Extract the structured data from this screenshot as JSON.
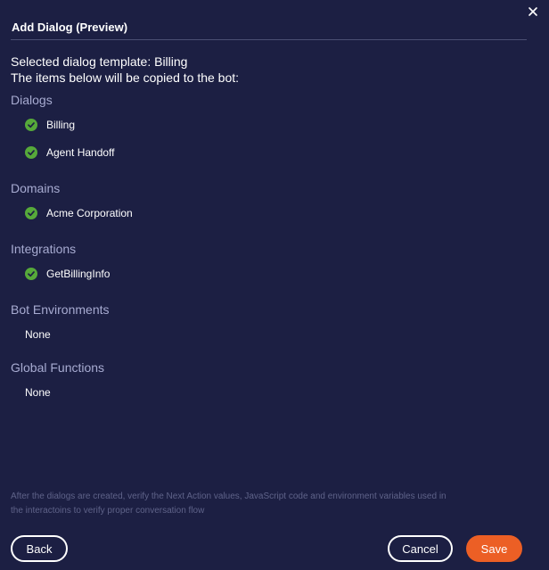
{
  "dialog": {
    "title": "Add Dialog (Preview)",
    "close_icon": "close-icon",
    "intro_line1": "Selected dialog template: Billing",
    "intro_line2": "The items below will be copied to the bot:"
  },
  "sections": {
    "dialogs": {
      "title": "Dialogs",
      "items": [
        "Billing",
        "Agent Handoff"
      ]
    },
    "domains": {
      "title": "Domains",
      "items": [
        "Acme Corporation"
      ]
    },
    "integrations": {
      "title": "Integrations",
      "items": [
        "GetBillingInfo"
      ]
    },
    "bot_environments": {
      "title": "Bot Environments",
      "empty": "None"
    },
    "global_functions": {
      "title": "Global Functions",
      "empty": "None"
    }
  },
  "footnote": {
    "line1": "After the dialogs are created, verify the Next Action values, JavaScript code and environment variables used in",
    "line2": "the interactoins to verify proper conversation flow"
  },
  "buttons": {
    "back": "Back",
    "cancel": "Cancel",
    "save": "Save"
  },
  "colors": {
    "background": "#1c1f43",
    "section_title": "#a7abd1",
    "check": "#56a93a",
    "accent": "#ec5f25"
  },
  "icons": {
    "check": "check-circle-icon"
  }
}
